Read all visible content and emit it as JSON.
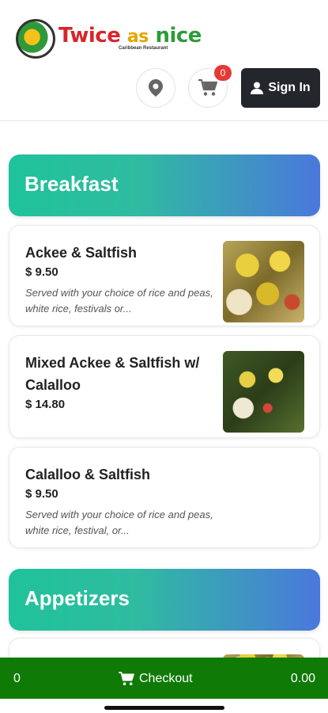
{
  "header": {
    "logo_word_1": "Twice",
    "logo_word_2": "as",
    "logo_word_3": "nice",
    "logo_tagline": "Caribbean Restaurant",
    "cart_count": "0",
    "signin_label": "Sign In"
  },
  "categories": [
    {
      "name": "Breakfast",
      "items": [
        {
          "name": "Ackee & Saltfish",
          "price": "$ 9.50",
          "description": "Served with your choice of rice and peas, white rice, festivals or..."
        },
        {
          "name": "Mixed Ackee & Saltfish w/ Calalloo",
          "price": "$ 14.80",
          "description": ""
        },
        {
          "name": "Calalloo & Saltfish",
          "price": "$ 9.50",
          "description": "Served with your choice of rice and peas, white rice, festival, or..."
        }
      ]
    },
    {
      "name": "Appetizers",
      "items": []
    }
  ],
  "footer": {
    "item_count": "0",
    "checkout_label": "Checkout",
    "total": "0.00"
  },
  "colors": {
    "banner_gradient_start": "#1fc29a",
    "banner_gradient_end": "#4a78dc",
    "checkout_bar": "#0f7a06",
    "signin_button": "#23272b",
    "badge": "#e53935"
  },
  "icons": [
    "map-pin-icon",
    "cart-icon",
    "user-icon"
  ]
}
